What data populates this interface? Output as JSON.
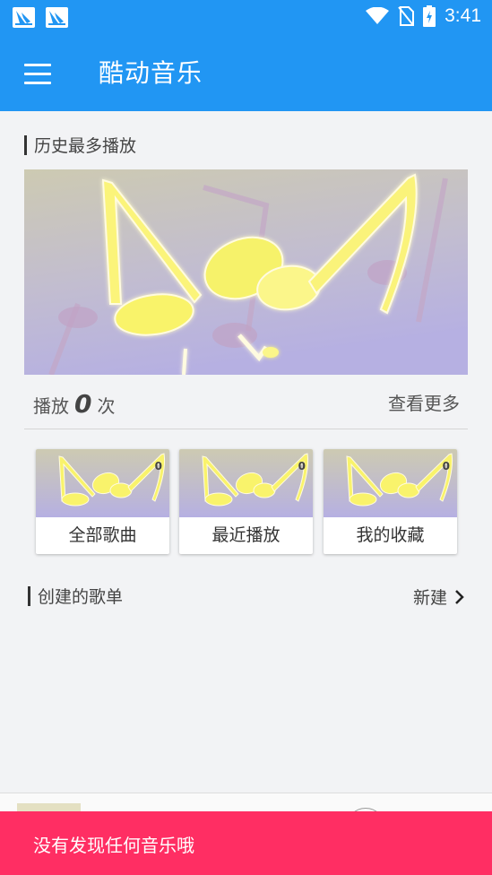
{
  "status_bar": {
    "time": "3:41",
    "icons": [
      "notification-app-icon",
      "notification-app-icon",
      "wifi-icon",
      "no-sim-icon",
      "battery-charging-icon"
    ]
  },
  "app_bar": {
    "menu_icon": "menu-icon",
    "title": "酷动音乐"
  },
  "history": {
    "section_title": "历史最多播放",
    "play_prefix": "播放",
    "play_count": "0",
    "play_suffix": "次",
    "see_more": "查看更多"
  },
  "cards": [
    {
      "label": "全部歌曲",
      "count": "0"
    },
    {
      "label": "最近播放",
      "count": "0"
    },
    {
      "label": "我的收藏",
      "count": "0"
    }
  ],
  "playlists": {
    "section_title": "创建的歌单",
    "new_label": "新建",
    "new_icon": "chevron-right-icon"
  },
  "snackbar": {
    "message": "没有发现任何音乐哦"
  },
  "colors": {
    "primary": "#2196f3",
    "snackbar": "#ff2e63",
    "background": "#f2f3f5"
  }
}
